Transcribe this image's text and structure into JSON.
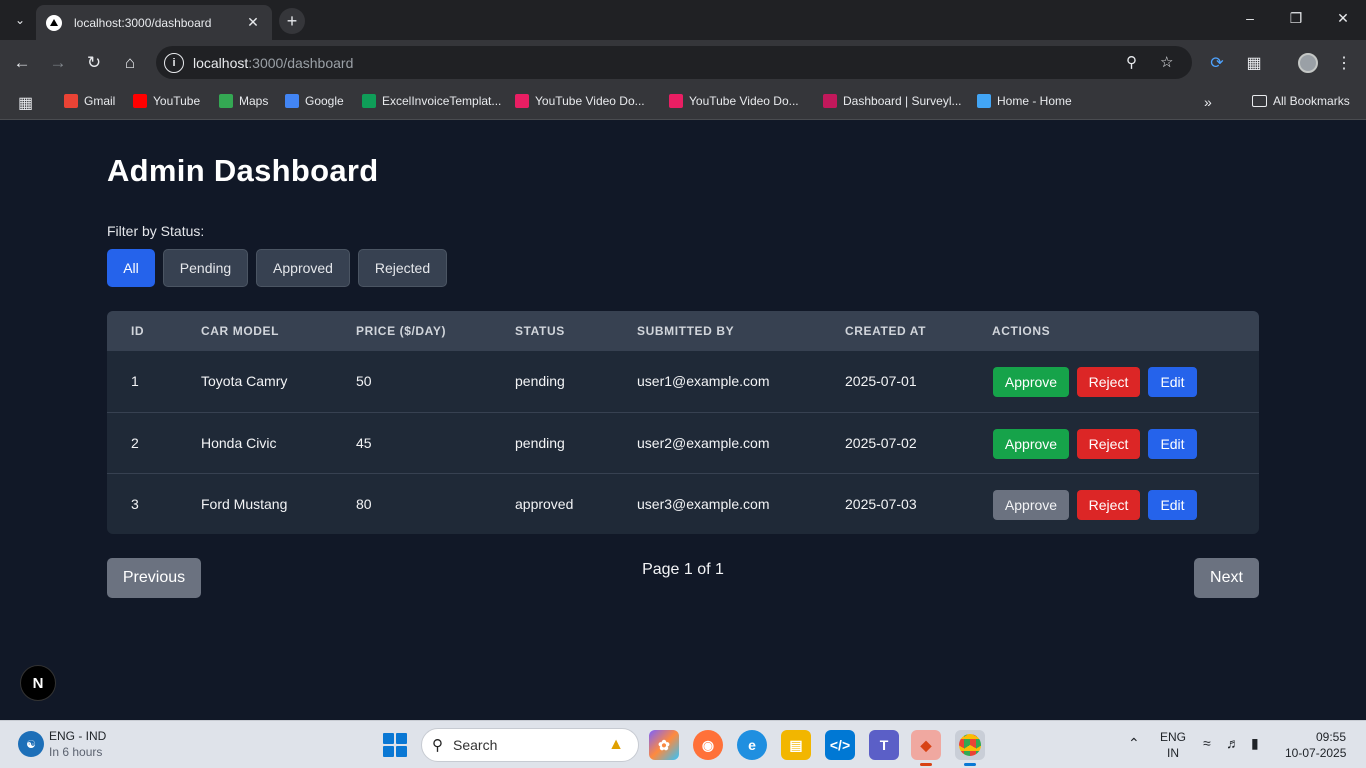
{
  "browser": {
    "tab_title": "localhost:3000/dashboard",
    "url_host": "localhost",
    "url_rest": ":3000/dashboard",
    "bookmarks": [
      {
        "label": "Gmail",
        "color": "#ea4335",
        "icon": "gmail-icon"
      },
      {
        "label": "YouTube",
        "color": "#ff0000",
        "icon": "youtube-icon"
      },
      {
        "label": "Maps",
        "color": "#34a853",
        "icon": "maps-icon"
      },
      {
        "label": "Google",
        "color": "#4285f4",
        "icon": "google-icon"
      },
      {
        "label": "ExcelInvoiceTemplat...",
        "color": "#0f9d58",
        "icon": "sheets-icon"
      },
      {
        "label": "YouTube Video Do...",
        "color": "#e91e63",
        "icon": "video-download-icon"
      },
      {
        "label": "YouTube Video Do...",
        "color": "#e91e63",
        "icon": "video-download-icon"
      },
      {
        "label": "Dashboard | Surveyl...",
        "color": "#c2185b",
        "icon": "survey-icon"
      },
      {
        "label": "Home - Home",
        "color": "#42a5f5",
        "icon": "home-site-icon"
      }
    ],
    "all_bookmarks": "All Bookmarks"
  },
  "page": {
    "title": "Admin Dashboard",
    "filter_label": "Filter by Status:",
    "filters": [
      "All",
      "Pending",
      "Approved",
      "Rejected"
    ],
    "active_filter": "All",
    "columns": [
      "ID",
      "CAR MODEL",
      "PRICE ($/DAY)",
      "STATUS",
      "SUBMITTED BY",
      "CREATED AT",
      "ACTIONS"
    ],
    "rows": [
      {
        "id": "1",
        "model": "Toyota Camry",
        "price": "50",
        "status": "pending",
        "submitted_by": "user1@example.com",
        "created_at": "2025-07-01",
        "approve_enabled": true
      },
      {
        "id": "2",
        "model": "Honda Civic",
        "price": "45",
        "status": "pending",
        "submitted_by": "user2@example.com",
        "created_at": "2025-07-02",
        "approve_enabled": true
      },
      {
        "id": "3",
        "model": "Ford Mustang",
        "price": "80",
        "status": "approved",
        "submitted_by": "user3@example.com",
        "created_at": "2025-07-03",
        "approve_enabled": false
      }
    ],
    "actions": {
      "approve": "Approve",
      "reject": "Reject",
      "edit": "Edit"
    },
    "pagination": {
      "previous": "Previous",
      "page_info": "Page 1 of 1",
      "next": "Next"
    },
    "badge": "N"
  },
  "taskbar": {
    "weather_title": "ENG - IND",
    "weather_sub": "In 6 hours",
    "search_placeholder": "Search",
    "lang_top": "ENG",
    "lang_bottom": "IN",
    "time": "09:55",
    "date": "10-07-2025"
  }
}
